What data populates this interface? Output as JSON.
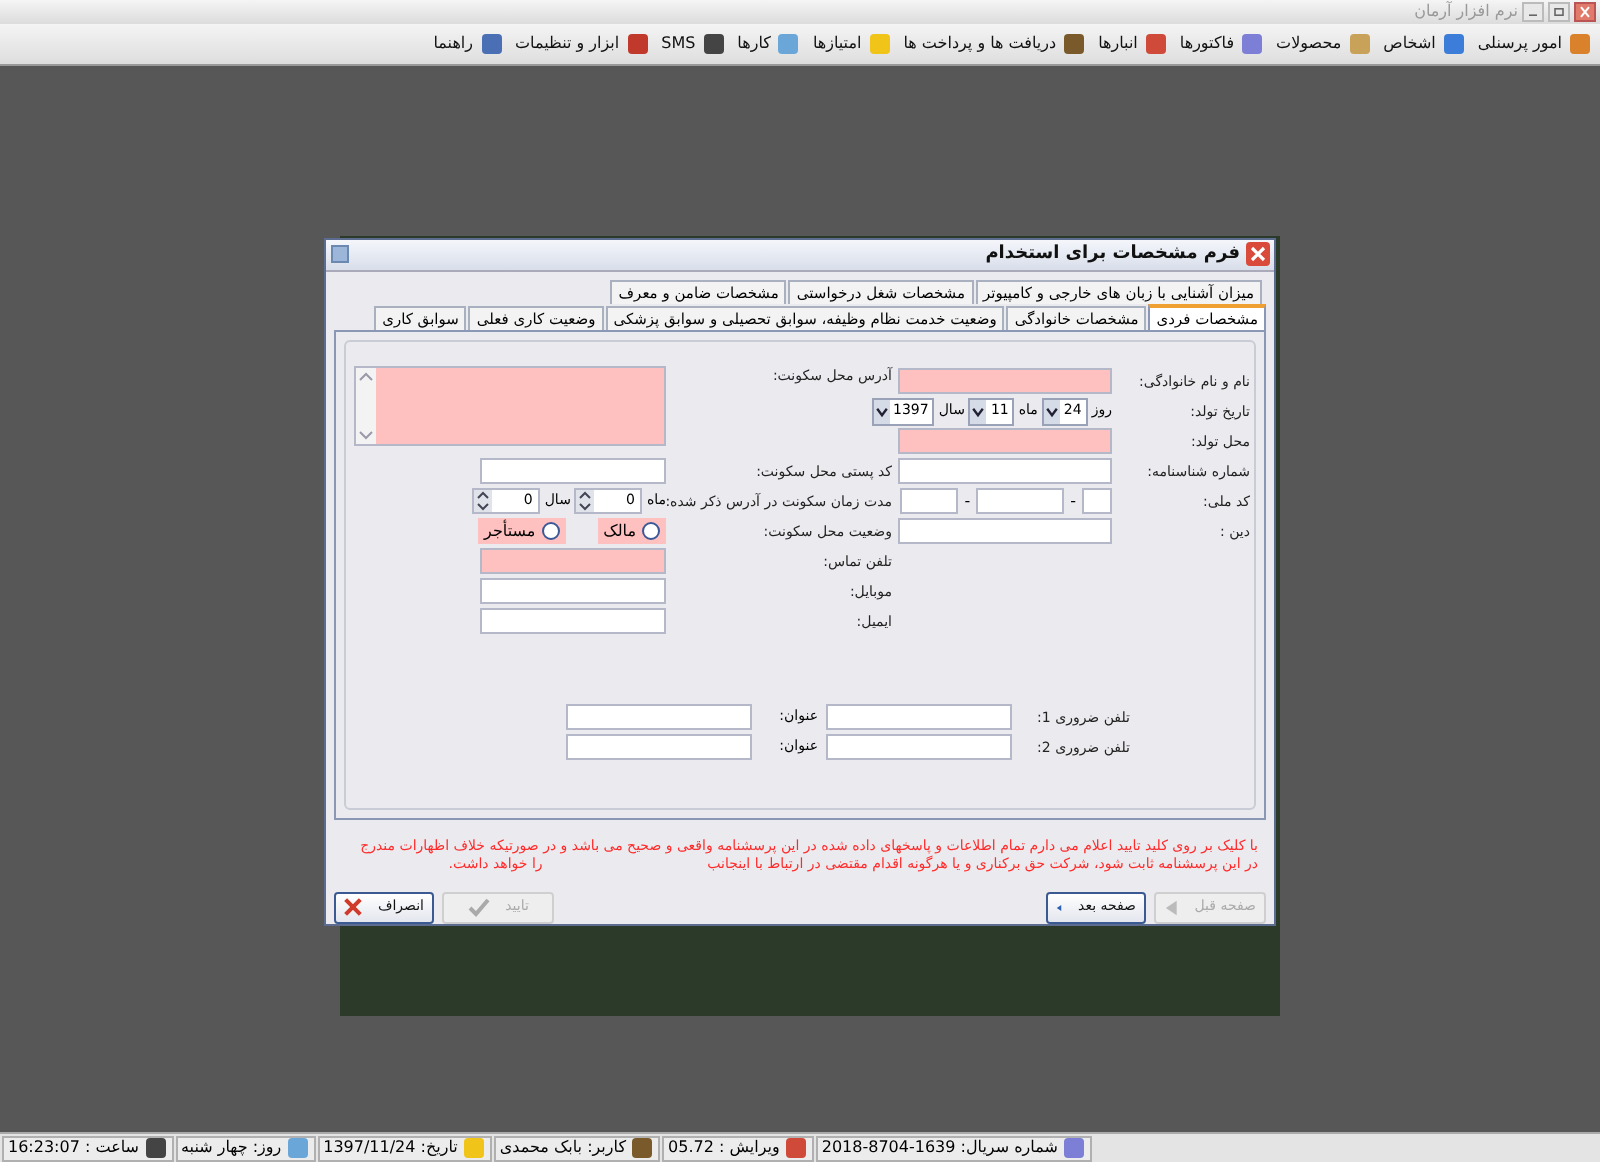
{
  "window": {
    "title": "نرم افزار آرمان"
  },
  "menu": [
    {
      "label": "امور پرسنلی"
    },
    {
      "label": "اشخاص"
    },
    {
      "label": "محصولات"
    },
    {
      "label": "فاکتورها"
    },
    {
      "label": "انبارها"
    },
    {
      "label": "دریافت ها و پرداخت ها"
    },
    {
      "label": "امتیازها"
    },
    {
      "label": "کارها"
    },
    {
      "label": "SMS"
    },
    {
      "label": "ابزار و تنظیمات"
    },
    {
      "label": "راهنما"
    }
  ],
  "dialog": {
    "title": "فرم مشخصات برای استخدام",
    "tab_rows": [
      [
        {
          "label": "میزان آشنایی با زبان های خارجی و کامپیوتر",
          "selected": false
        },
        {
          "label": "مشخصات شغل درخواستی",
          "selected": false
        },
        {
          "label": "مشخصات ضامن و معرف",
          "selected": false
        }
      ],
      [
        {
          "label": "مشخصات فردی",
          "selected": true
        },
        {
          "label": "مشخصات خانوادگی",
          "selected": false
        },
        {
          "label": "وضعیت خدمت نظام وظیفه، سوابق تحصیلی و سوابق پزشکی",
          "selected": false
        },
        {
          "label": "وضعیت کاری فعلی",
          "selected": false
        },
        {
          "label": "سوابق کاری",
          "selected": false
        }
      ]
    ],
    "right_fields": [
      {
        "kind": "text",
        "label": "نام و نام خانوادگی:",
        "required": true
      },
      {
        "kind": "date",
        "label": "تاریخ تولد:",
        "parts": [
          {
            "label": "روز",
            "value": "24"
          },
          {
            "label": "ماه",
            "value": "11"
          },
          {
            "label": "سال",
            "value": "1397"
          }
        ]
      },
      {
        "kind": "text",
        "label": "محل تولد:",
        "required": true
      },
      {
        "kind": "text",
        "label": "شماره شناسنامه:",
        "required": false
      },
      {
        "kind": "national_id",
        "label": "کد ملی:",
        "separators": [
          "-",
          "-"
        ]
      },
      {
        "kind": "text",
        "label": "دین :",
        "required": false
      }
    ],
    "left_fields": [
      {
        "kind": "textarea",
        "label": "آدرس محل سکونت:",
        "required": true
      },
      {
        "kind": "text",
        "label": "کد پستی محل سکونت:",
        "required": false
      },
      {
        "kind": "duration",
        "label": "مدت زمان سکونت در آدرس ذکر شده:",
        "parts": [
          {
            "label": "ماه",
            "value": "0"
          },
          {
            "label": "سال",
            "value": "0"
          }
        ]
      },
      {
        "kind": "radio",
        "label": "وضعیت محل سکونت:",
        "required": true,
        "options": [
          {
            "label": "مالک",
            "selected": false
          },
          {
            "label": "مستأجر",
            "selected": false
          }
        ]
      },
      {
        "kind": "text",
        "label": "تلفن تماس:",
        "required": true
      },
      {
        "kind": "text",
        "label": "موبایل:",
        "required": false
      },
      {
        "kind": "text",
        "label": "ایمیل:",
        "required": false
      }
    ],
    "emergency_phones": [
      {
        "label": "تلفن ضروری 1:",
        "title_label": "عنوان:"
      },
      {
        "label": "تلفن ضروری 2:",
        "title_label": "عنوان:"
      }
    ],
    "notice": [
      "با کلیک بر روی کلید تایید اعلام می دارم تمام اطلاعات و پاسخهای داده شده در این پرسشنامه واقعی و صحیح می باشد و در صورتیکه خلاف اظهارات مندرج",
      "در این پرسشنامه ثابت شود، شرکت حق برکناری و یا هرگونه اقدام مقتضی در ارتباط با اینجانب                                     را خواهد داشت."
    ],
    "nav_buttons": [
      {
        "label": "صفحه قبل",
        "disabled": true
      },
      {
        "label": "صفحه بعد",
        "disabled": false
      }
    ],
    "action_buttons": [
      {
        "label": "تایید",
        "disabled": true
      },
      {
        "label": "انصراف",
        "disabled": false
      }
    ]
  },
  "status_bar": [
    {
      "label": "شماره سریال: 1639-8704-2018"
    },
    {
      "label": "ویرایش : 05.72"
    },
    {
      "label": "کاربر: بابک محمدی"
    },
    {
      "label": "تاریخ: 1397/11/24"
    },
    {
      "label": "روز: چهار شنبه"
    },
    {
      "label": "ساعت : 16:23:07"
    }
  ]
}
